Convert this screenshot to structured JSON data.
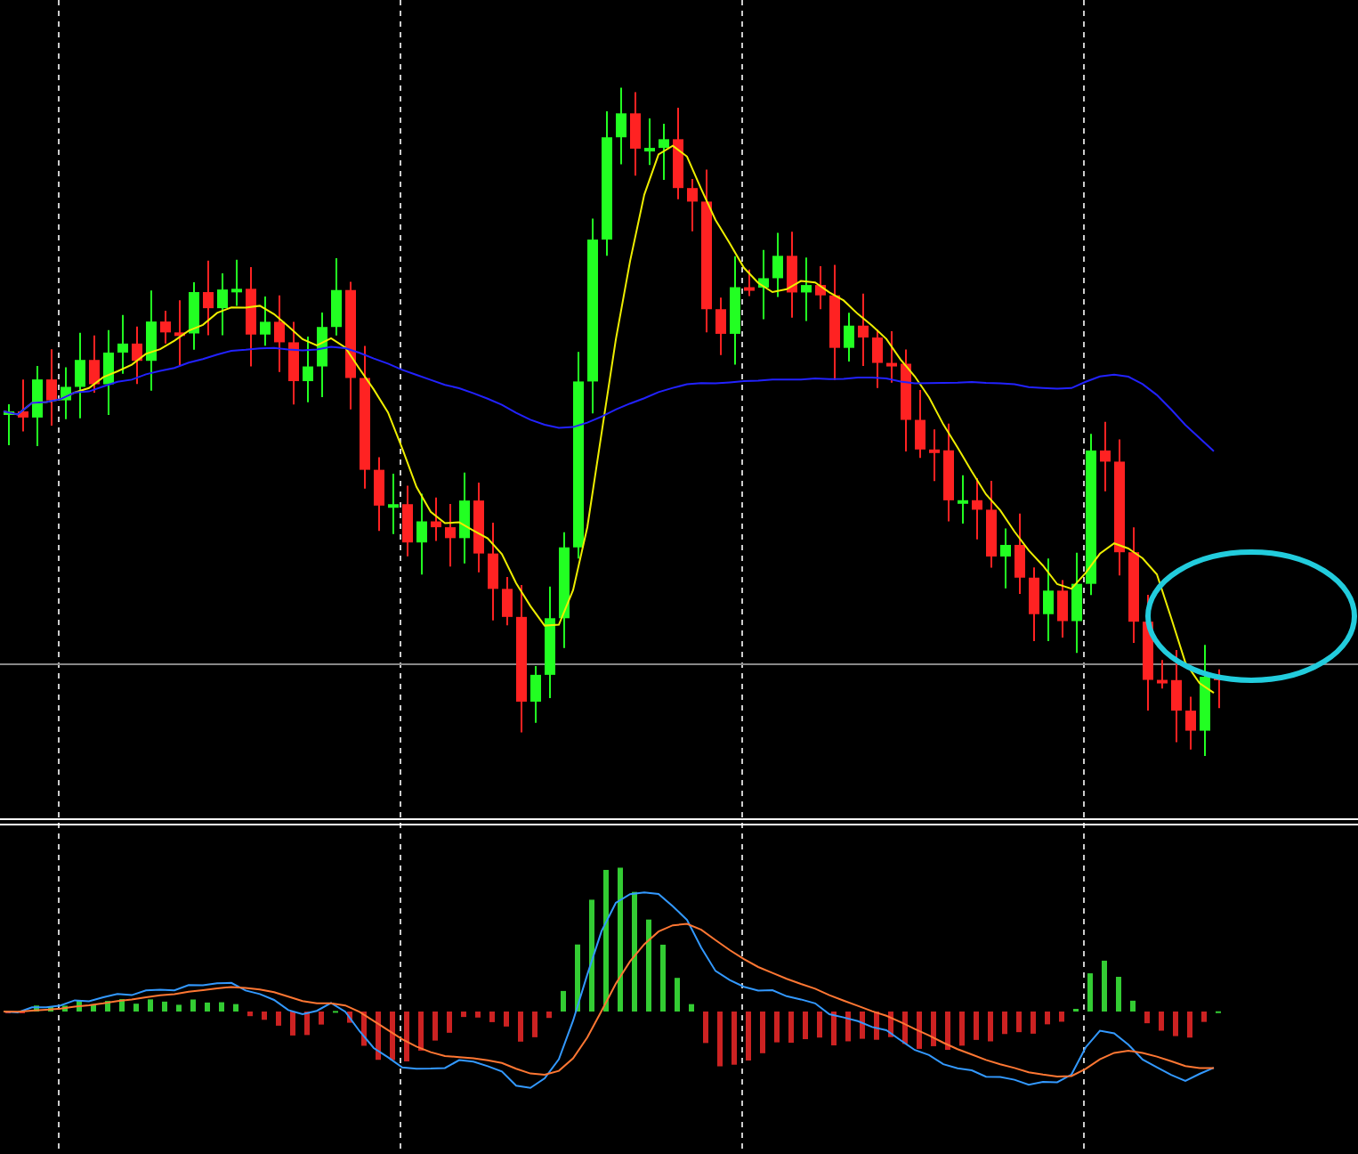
{
  "price_panel": {
    "kind": "candlestick"
  },
  "indicator_panel": {
    "kind": "macd"
  },
  "annotation": {
    "kind": "ellipse"
  }
}
